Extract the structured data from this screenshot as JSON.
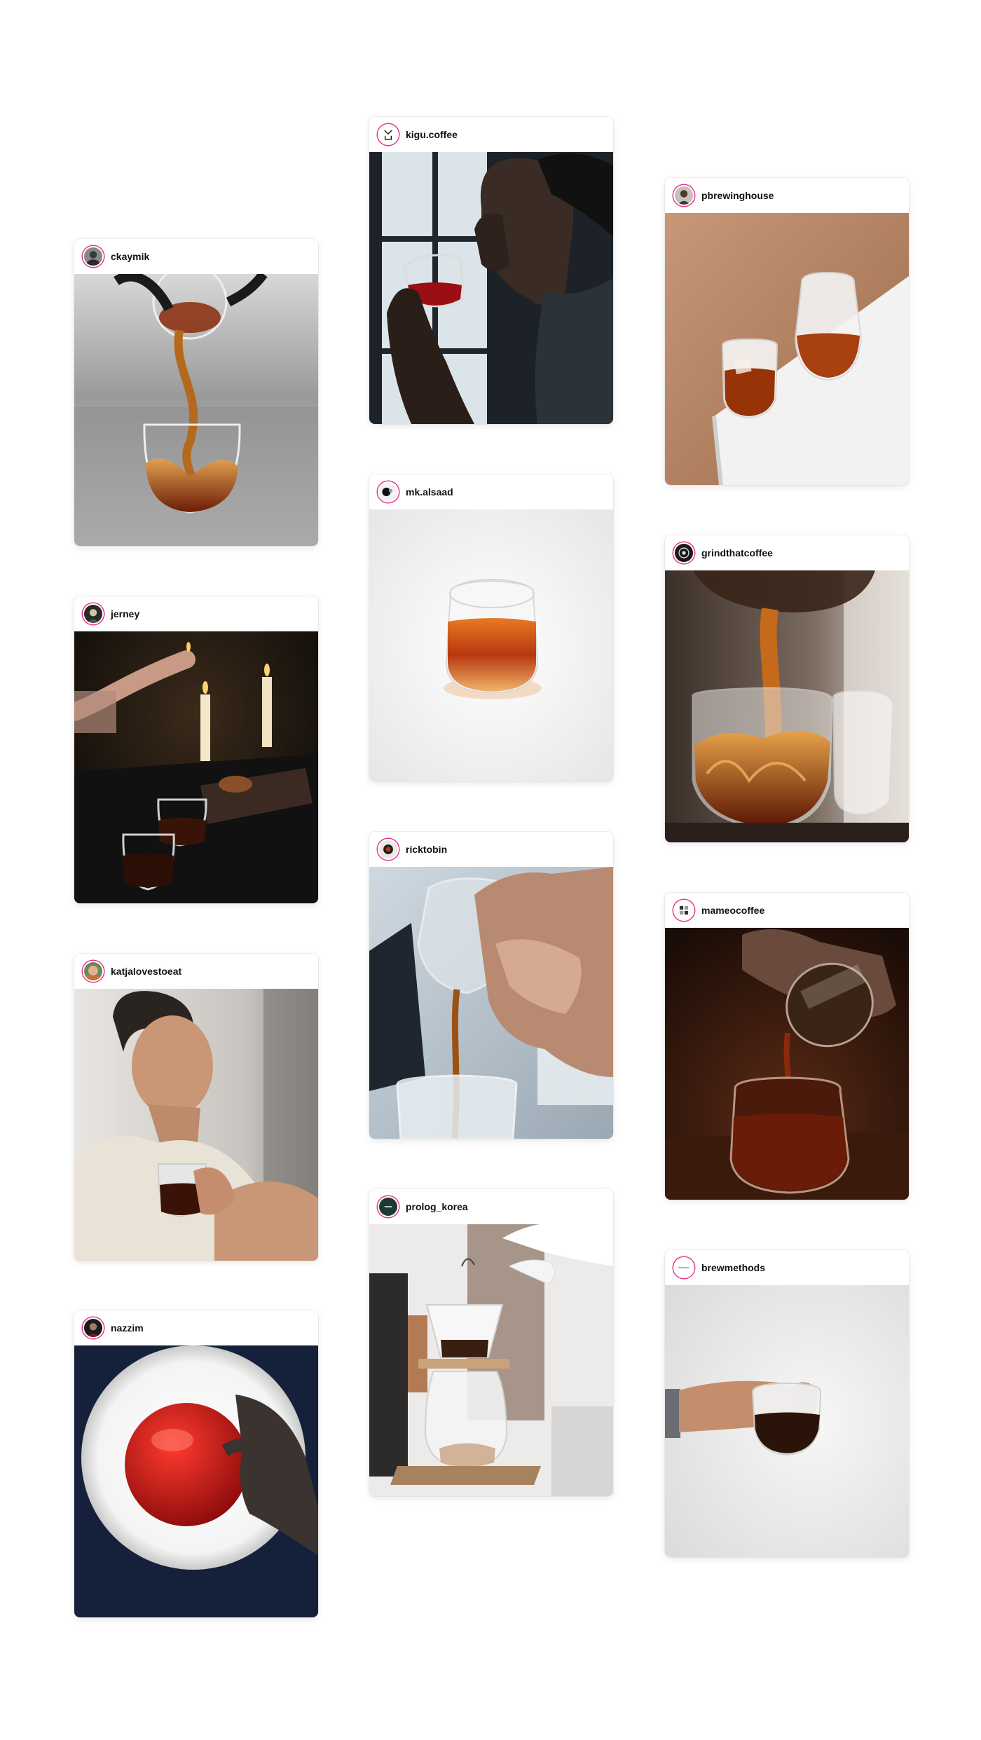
{
  "feed": {
    "posts": [
      {
        "username": "ckaymik"
      },
      {
        "username": "jerney"
      },
      {
        "username": "katjalovestoeat"
      },
      {
        "username": "nazzim"
      },
      {
        "username": "kigu.coffee"
      },
      {
        "username": "mk.alsaad"
      },
      {
        "username": "ricktobin"
      },
      {
        "username": "prolog_korea"
      },
      {
        "username": "pbrewinghouse"
      },
      {
        "username": "grindthatcoffee"
      },
      {
        "username": "mameocoffee"
      },
      {
        "username": "brewmethods"
      }
    ]
  },
  "colors": {
    "avatar_ring": "#e6308a",
    "coffee": "#7a2a0c",
    "card_background": "#ffffff"
  }
}
